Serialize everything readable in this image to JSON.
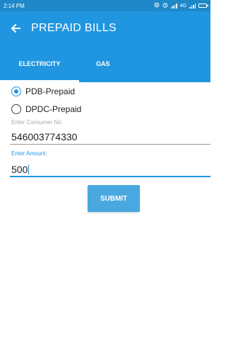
{
  "status_bar": {
    "time": "2:14 PM",
    "network": "4G",
    "icons": [
      "data-saver-icon",
      "alarm-icon",
      "signal-icon",
      "battery-icon"
    ]
  },
  "app_bar": {
    "title": "PREPAID BILLS",
    "back_icon": "arrow-left-icon",
    "color": "#2196e0"
  },
  "tabs": [
    {
      "label": "ELECTRICITY",
      "active": true
    },
    {
      "label": "GAS",
      "active": false
    }
  ],
  "provider_options": [
    {
      "label": "PDB-Prepaid",
      "checked": true
    },
    {
      "label": "DPDC-Prepaid",
      "checked": false
    }
  ],
  "consumer_field": {
    "label": "Enter Consumer No:",
    "value": "546003774330"
  },
  "amount_field": {
    "label": "Enter Amount:",
    "value": "500"
  },
  "submit_label": "SUBMIT"
}
